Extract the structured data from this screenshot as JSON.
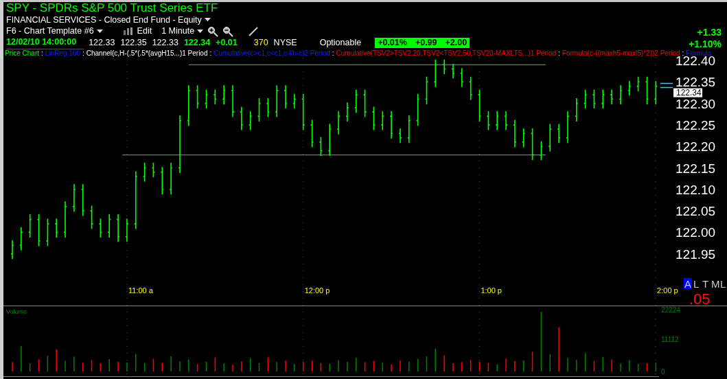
{
  "title": "SPY - SPDRs S&P 500 Trust Series ETF",
  "subtitle": "FINANCIAL SERVICES - Closed End Fund - Equity",
  "toolbar": {
    "template": "F6 - Chart Template #6",
    "edit": "Edit",
    "interval": "1 Minute"
  },
  "quote": {
    "datetime": "12/02/10 14:00:00",
    "open": "122.33",
    "high": "122.35",
    "low": "122.33",
    "close": "122.34",
    "change": "+0.01",
    "volume": "370",
    "exchange": "NYSE",
    "optionable": "Optionable",
    "badges": [
      "+0.01%",
      "+0.99",
      "+2.00"
    ]
  },
  "day_change": {
    "points": "+1.33",
    "percent": "+1.10%"
  },
  "legend": [
    {
      "text": "Price Chart",
      "kind": "price",
      "separator": ":"
    },
    {
      "text": "LinReg 100",
      "kind": "overlay",
      "separator": ":"
    },
    {
      "text": "Channel(c,H-(.5*(.5*(avgH15...)1 Period",
      "kind": "channel",
      "separator": ":"
    },
    {
      "text": "Cumulative(c>c1,c<c1,c-l/h-c)2 Period",
      "kind": "overlay",
      "separator": ":"
    },
    {
      "text": "Cumulative(TSV2>TSV2.20,TSV2<TSV2.50,TSV20-MAXLTS...)1 Period",
      "kind": "alert",
      "separator": ":"
    },
    {
      "text": "Formula(c-((maxh5-maxl5)*2))2 Period",
      "kind": "alert",
      "separator": ":"
    },
    {
      "text": "Formula",
      "kind": "overlay"
    }
  ],
  "price_chart": {
    "price_labels": [
      "122.40",
      "122.35",
      "122.30",
      "122.25",
      "122.20",
      "122.15",
      "122.10",
      "122.05",
      "122.00",
      "121.95"
    ],
    "time_labels": [
      "11:00 a",
      "12:00 p",
      "1:00 p",
      "2:00 p"
    ],
    "last_price": "122.34"
  },
  "mode_letters": [
    {
      "text": "A",
      "selected": true
    },
    {
      "text": "L",
      "selected": false
    },
    {
      "text": "T",
      "selected": false
    },
    {
      "text": "M",
      "selected": false
    },
    {
      "text": "L",
      "selected": false
    }
  ],
  "indicator_value": ".05",
  "volume_chart": {
    "label": "Volume",
    "axis_labels": [
      "22224",
      "11112",
      "0"
    ]
  }
}
